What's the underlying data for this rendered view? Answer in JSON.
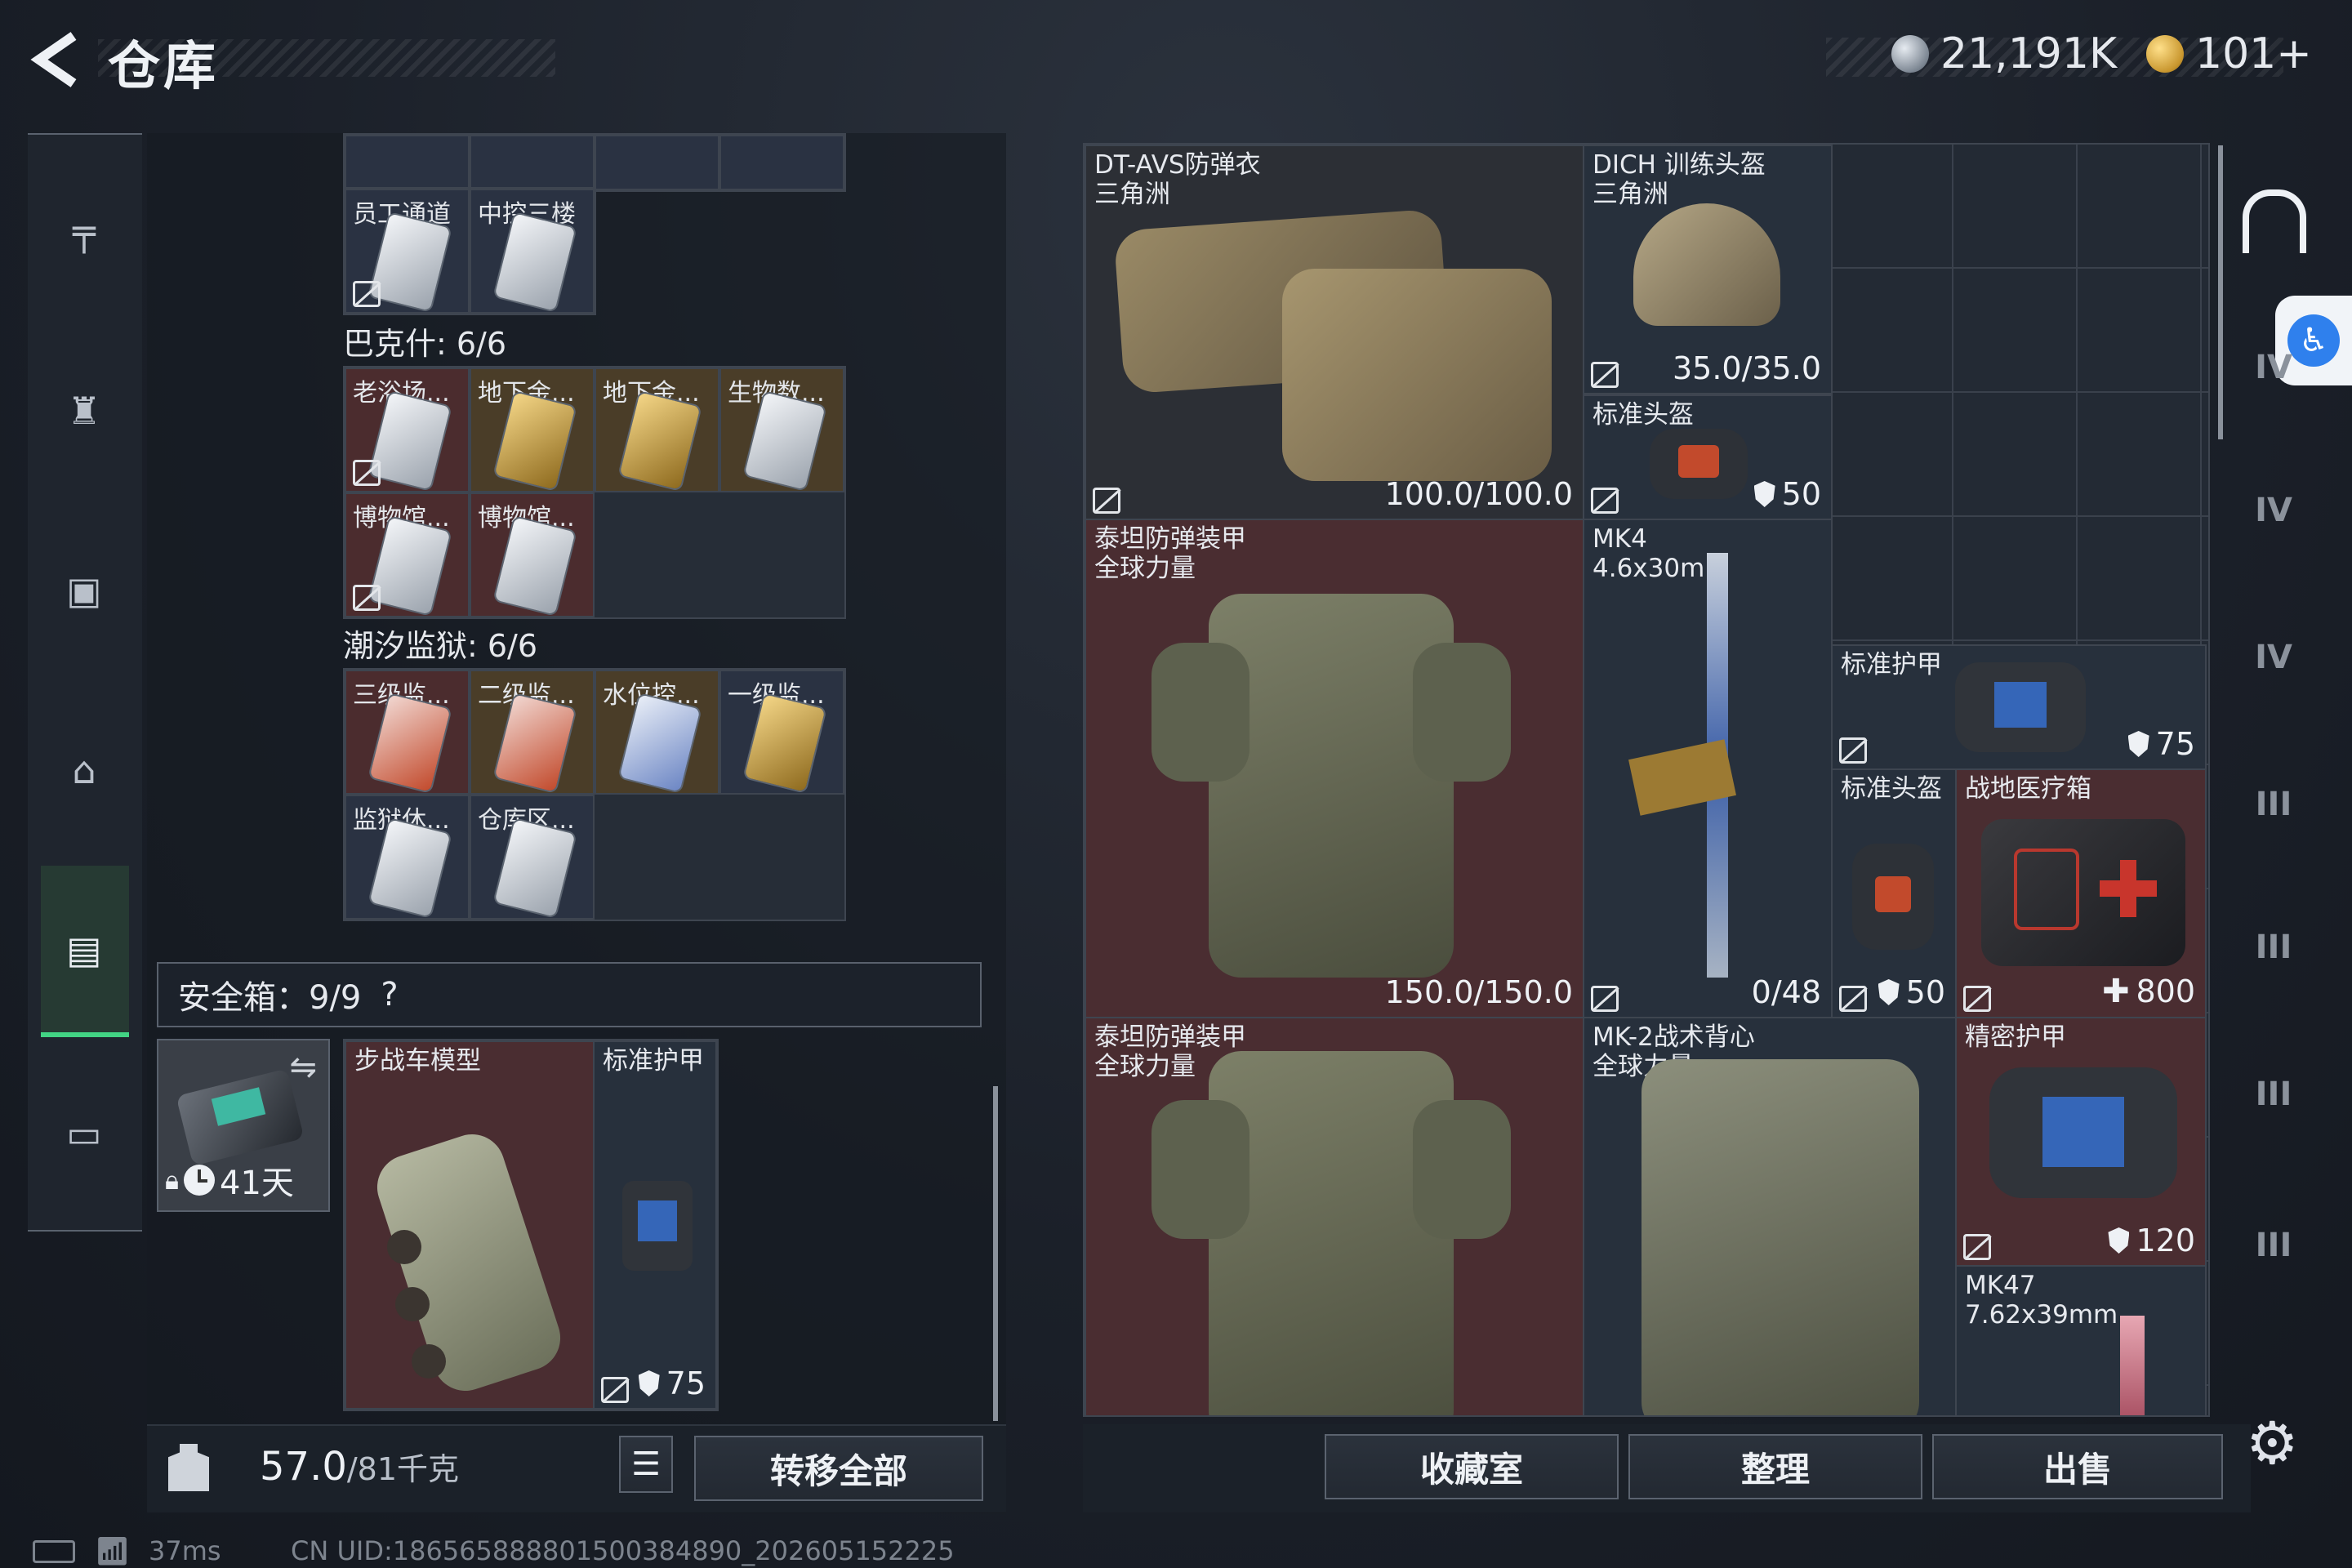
{
  "header": {
    "title": "仓库"
  },
  "currency": [
    {
      "value": "21,191K",
      "kind": "silver"
    },
    {
      "value": "101+",
      "kind": "gold"
    }
  ],
  "rail": [
    {
      "name": "weapon-icon",
      "glyph": "╤"
    },
    {
      "name": "armor-icon",
      "glyph": "♜"
    },
    {
      "name": "backpack-icon",
      "glyph": "▣"
    },
    {
      "name": "bag-icon",
      "glyph": "⌂"
    },
    {
      "name": "keycard-icon",
      "glyph": "▤"
    },
    {
      "name": "briefcase-icon",
      "glyph": "▭"
    }
  ],
  "keys": {
    "top_labels": [
      "员工通道",
      "中控三楼"
    ],
    "bakesh_title": "巴克什: 6/6",
    "bakesh": [
      "老浴场...",
      "地下金...",
      "地下金...",
      "生物数...",
      "博物馆...",
      "博物馆..."
    ],
    "prison_title": "潮汐监狱: 6/6",
    "prison": [
      "三级监...",
      "二级监...",
      "水位控...",
      "一级监...",
      "监狱休...",
      "仓库区..."
    ]
  },
  "safebox": {
    "label": "安全箱：9/9",
    "help": "?",
    "timer": "41天"
  },
  "pouch": [
    {
      "name": "步战车模型"
    },
    {
      "name": "标准护甲",
      "value": "75"
    }
  ],
  "weight": {
    "current": "57.0",
    "max": "/81千克"
  },
  "buttons": {
    "transfer": "转移全部",
    "collection": "收藏室",
    "sort": "整理",
    "sell": "出售"
  },
  "items": {
    "dtavs": {
      "name": "DT-AVS防弹衣",
      "sub": "三角洲",
      "value": "100.0/100.0"
    },
    "dich": {
      "name": "DICH 训练头盔",
      "sub": "三角洲",
      "value": "35.0/35.0"
    },
    "helmet1": {
      "name": "标准头盔",
      "value": "50"
    },
    "titan1": {
      "name": "泰坦防弹装甲",
      "sub": "全球力量",
      "value": "150.0/150.0"
    },
    "mk4": {
      "name": "MK4",
      "sub": "4.6x30mm",
      "value": "0/48"
    },
    "armor1": {
      "name": "标准护甲",
      "value": "75"
    },
    "helmet2": {
      "name": "标准头盔",
      "value": "50"
    },
    "medkit": {
      "name": "战地医疗箱",
      "value": "800"
    },
    "titan2": {
      "name": "泰坦防弹装甲",
      "sub": "全球力量"
    },
    "mk2": {
      "name": "MK-2战术背心",
      "sub": "全球力量"
    },
    "precision": {
      "name": "精密护甲",
      "value": "120"
    },
    "mk47": {
      "name": "MK47",
      "sub": "7.62x39mm"
    }
  },
  "right_rail": [
    "IV",
    "IV",
    "IV",
    "III",
    "III",
    "III",
    "III"
  ],
  "status": {
    "ping": "37ms",
    "uid": "CN UID:186565888801500384890_202605152225"
  }
}
